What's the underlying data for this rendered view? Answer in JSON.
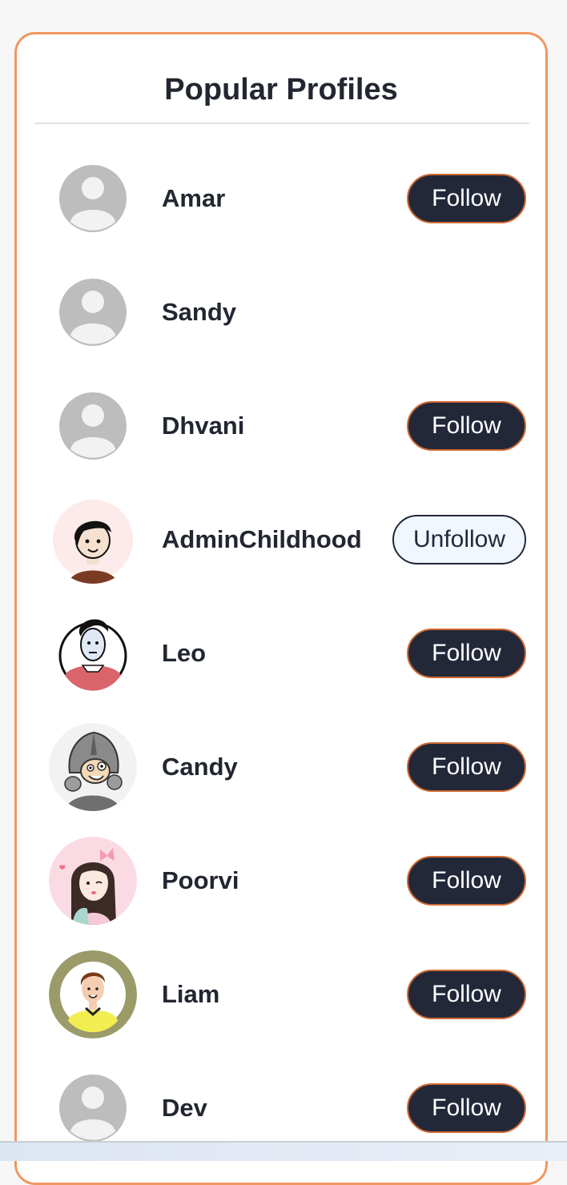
{
  "panel": {
    "title": "Popular Profiles"
  },
  "profiles": [
    {
      "name": "Amar",
      "avatar": "default-avatar-icon",
      "action": "Follow"
    },
    {
      "name": "Sandy",
      "avatar": "default-avatar-icon",
      "action": ""
    },
    {
      "name": "Dhvani",
      "avatar": "default-avatar-icon",
      "action": "Follow"
    },
    {
      "name": "AdminChildhood",
      "avatar": "cartoon-boy-avatar",
      "action": "Unfollow"
    },
    {
      "name": "Leo",
      "avatar": "cartoon-sketch-avatar",
      "action": "Follow"
    },
    {
      "name": "Candy",
      "avatar": "cartoon-knight-avatar",
      "action": "Follow"
    },
    {
      "name": "Poorvi",
      "avatar": "cartoon-girl-avatar",
      "action": "Follow"
    },
    {
      "name": "Liam",
      "avatar": "cartoon-man-avatar",
      "action": "Follow"
    },
    {
      "name": "Dev",
      "avatar": "default-avatar-icon",
      "action": "Follow"
    }
  ],
  "colors": {
    "accent_border": "#f0975e",
    "follow_bg": "#232839",
    "follow_border": "#cf6a33",
    "unfollow_bg": "#f1f6ff",
    "text": "#222631"
  }
}
